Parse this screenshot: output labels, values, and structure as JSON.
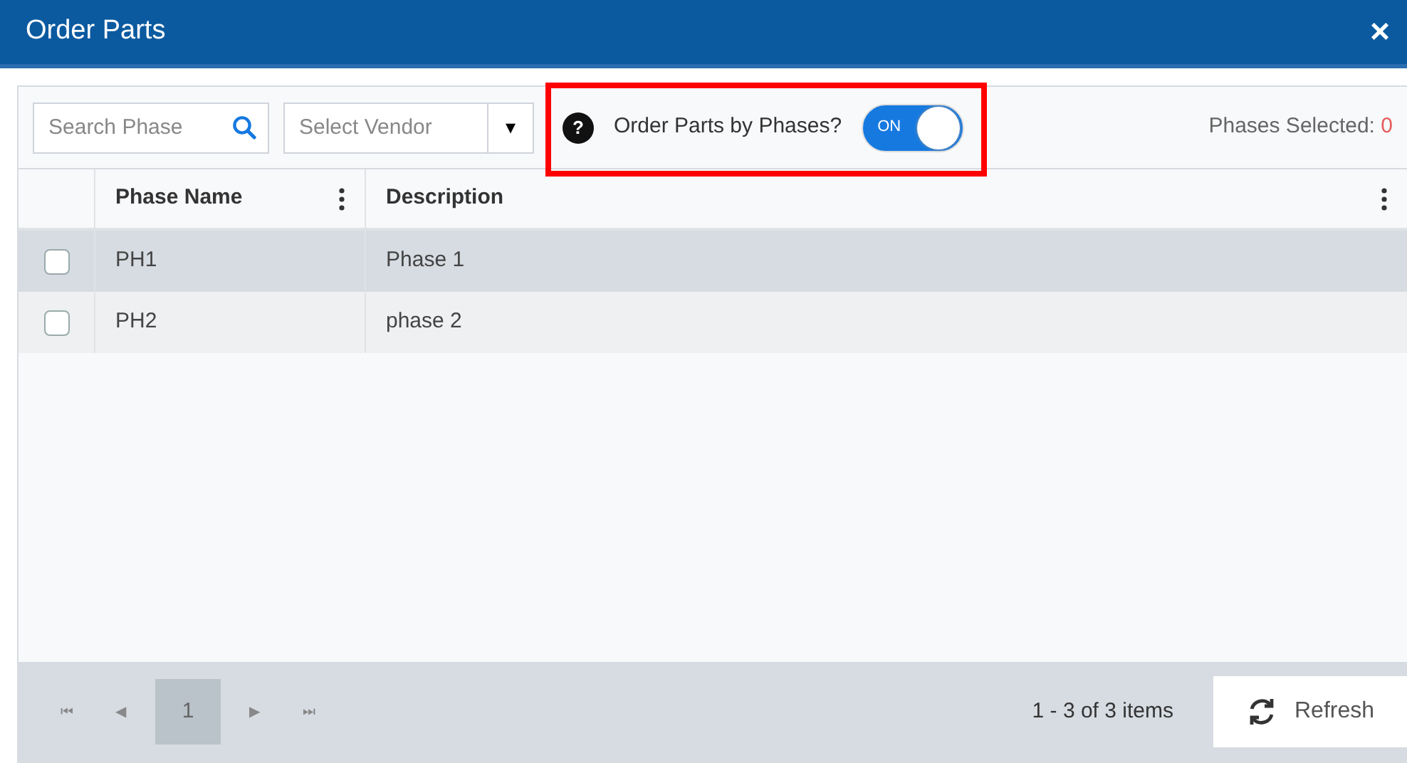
{
  "window": {
    "title": "Order Parts",
    "close": "×"
  },
  "toolbar": {
    "search": {
      "placeholder": "Search Phase"
    },
    "vendor": {
      "placeholder": "Select Vendor",
      "caret": "▾"
    },
    "help": "?",
    "toggle_label": "Order Parts by Phases?",
    "toggle": {
      "on": true,
      "text": "ON"
    },
    "highlighted": true,
    "selected_label": "Phases Selected:",
    "selected_count": "0"
  },
  "table": {
    "columns": [
      {
        "label": "Phase Name",
        "menu": true
      },
      {
        "label": "Description",
        "menu": true
      }
    ],
    "rows": [
      {
        "checked": false,
        "selected": true,
        "cells": [
          "PH1",
          "Phase 1"
        ]
      },
      {
        "checked": false,
        "selected": false,
        "cells": [
          "PH2",
          "phase 2"
        ]
      }
    ]
  },
  "pager": {
    "first": "⏮",
    "prev": "◀",
    "pages": [
      {
        "label": "1",
        "selected": true
      }
    ],
    "next": "▶",
    "last": "⏭",
    "summary": "1 - 3 of 3 items",
    "refresh": "Refresh"
  }
}
